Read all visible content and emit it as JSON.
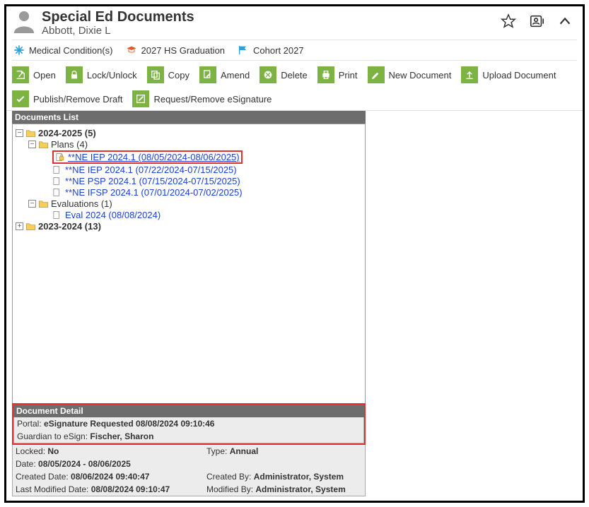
{
  "header": {
    "title": "Special Ed Documents",
    "student": "Abbott, Dixie L"
  },
  "badges": {
    "medical": "Medical Condition(s)",
    "grad": "2027 HS Graduation",
    "cohort": "Cohort 2027"
  },
  "toolbar": {
    "open": "Open",
    "lock": "Lock/Unlock",
    "copy": "Copy",
    "amend": "Amend",
    "delete": "Delete",
    "print": "Print",
    "newdoc": "New Document",
    "upload": "Upload Document",
    "publish": "Publish/Remove Draft",
    "esig": "Request/Remove eSignature"
  },
  "docsPanel": {
    "title": "Documents List"
  },
  "tree": {
    "y2024": "2024-2025 (5)",
    "plans": "Plans (4)",
    "doc1": "**NE IEP 2024.1 (08/05/2024-08/06/2025)",
    "doc2": "**NE IEP 2024.1 (07/22/2024-07/15/2025)",
    "doc3": "**NE PSP 2024.1 (07/15/2024-07/15/2025)",
    "doc4": "**NE IFSP 2024.1 (07/01/2024-07/02/2025)",
    "evals": "Evaluations (1)",
    "eval1": "Eval 2024 (08/08/2024)",
    "y2023": "2023-2024 (13)"
  },
  "detail": {
    "title": "Document Detail",
    "portalLabel": "Portal: ",
    "portalValue": "eSignature Requested 08/08/2024 09:10:46",
    "guardianLabel": "Guardian to eSign: ",
    "guardianValue": "Fischer, Sharon",
    "lockedLabel": "Locked: ",
    "lockedValue": "No",
    "typeLabel": "Type: ",
    "typeValue": "Annual",
    "dateLabel": "Date: ",
    "dateValue": "08/05/2024 - 08/06/2025",
    "createdDateLabel": "Created Date: ",
    "createdDateValue": "08/06/2024 09:40:47",
    "createdByLabel": "Created By: ",
    "createdByValue": "Administrator, System",
    "modifiedDateLabel": "Last Modified Date: ",
    "modifiedDateValue": "08/08/2024 09:10:47",
    "modifiedByLabel": "Modified By: ",
    "modifiedByValue": "Administrator, System"
  }
}
